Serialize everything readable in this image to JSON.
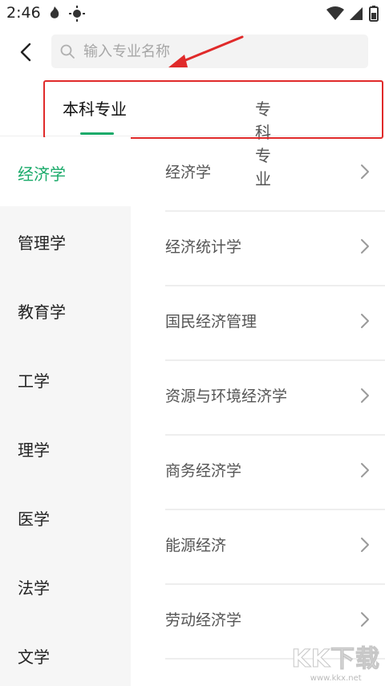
{
  "status_bar": {
    "time": "2:46"
  },
  "search": {
    "placeholder": "输入专业名称"
  },
  "tabs": [
    {
      "label": "本科专业",
      "active": true
    },
    {
      "label": "专科专业",
      "active": false
    }
  ],
  "sidebar": {
    "items": [
      {
        "label": "经济学",
        "active": true
      },
      {
        "label": "管理学"
      },
      {
        "label": "教育学"
      },
      {
        "label": "工学"
      },
      {
        "label": "理学"
      },
      {
        "label": "医学"
      },
      {
        "label": "法学"
      },
      {
        "label": "文学"
      }
    ]
  },
  "majors": [
    {
      "label": "经济学"
    },
    {
      "label": "经济统计学"
    },
    {
      "label": "国民经济管理"
    },
    {
      "label": "资源与环境经济学"
    },
    {
      "label": "商务经济学"
    },
    {
      "label": "能源经济"
    },
    {
      "label": "劳动经济学"
    }
  ],
  "watermark": {
    "logo": "KK下载",
    "url": "www.kkx.net"
  },
  "colors": {
    "accent": "#1aaa6a",
    "annotation": "#e02a2a"
  }
}
